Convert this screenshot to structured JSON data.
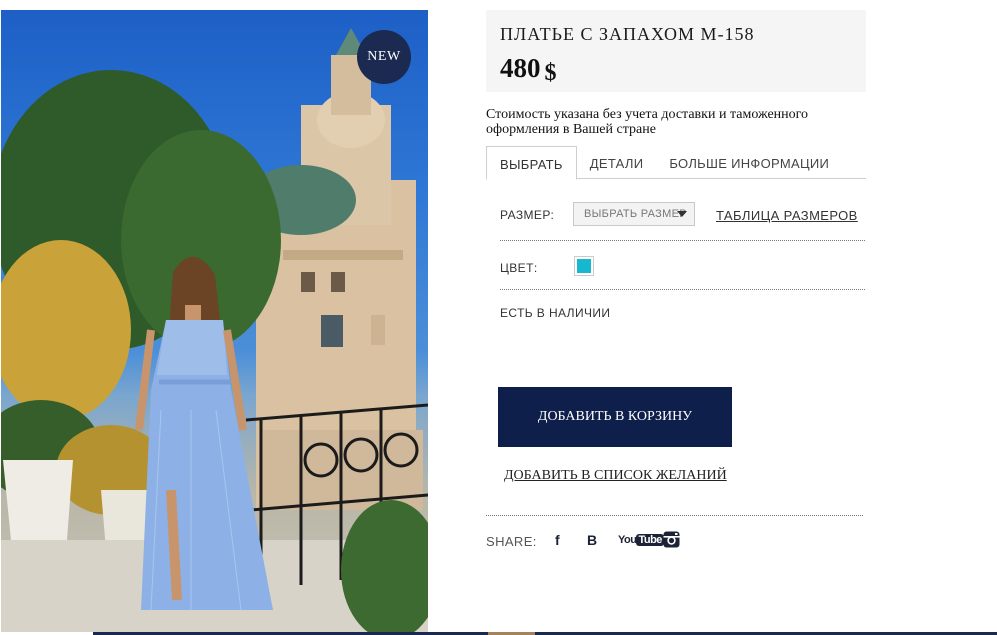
{
  "product": {
    "badge": "NEW",
    "title": "ПЛАТЬЕ С ЗАПАХОМ М-158",
    "price": "480",
    "currency": "$",
    "price_note": "Стоимость указана без учета доставки и таможенного оформления в Вашей стране"
  },
  "tabs": [
    {
      "label": "ВЫБРАТЬ",
      "active": true
    },
    {
      "label": "ДЕТАЛИ",
      "active": false
    },
    {
      "label": "БОЛЬШЕ ИНФОРМАЦИИ",
      "active": false
    }
  ],
  "options": {
    "size_label": "РАЗМЕР:",
    "size_select_value": "ВЫБРАТЬ РАЗМЕР",
    "size_table_link": "ТАБЛИЦА РАЗМЕРОВ",
    "color_label": "ЦВЕТ:",
    "color_swatch": "#16b7cf",
    "stock": "ЕСТЬ В НАЛИЧИИ"
  },
  "actions": {
    "add_to_cart": "ДОБАВИТЬ В КОРЗИНУ",
    "add_to_wishlist": "ДОБАВИТЬ В СПИСОК ЖЕЛАНИЙ"
  },
  "share": {
    "label": "SHARE:",
    "icons": [
      "facebook-icon",
      "vk-icon",
      "youtube-icon",
      "instagram-icon"
    ],
    "facebook": "f",
    "vk": "B",
    "youtube_a": "You",
    "youtube_b": "Tube"
  },
  "colors": {
    "accent_dark": "#0f1f4b",
    "badge": "#1c2a52"
  }
}
